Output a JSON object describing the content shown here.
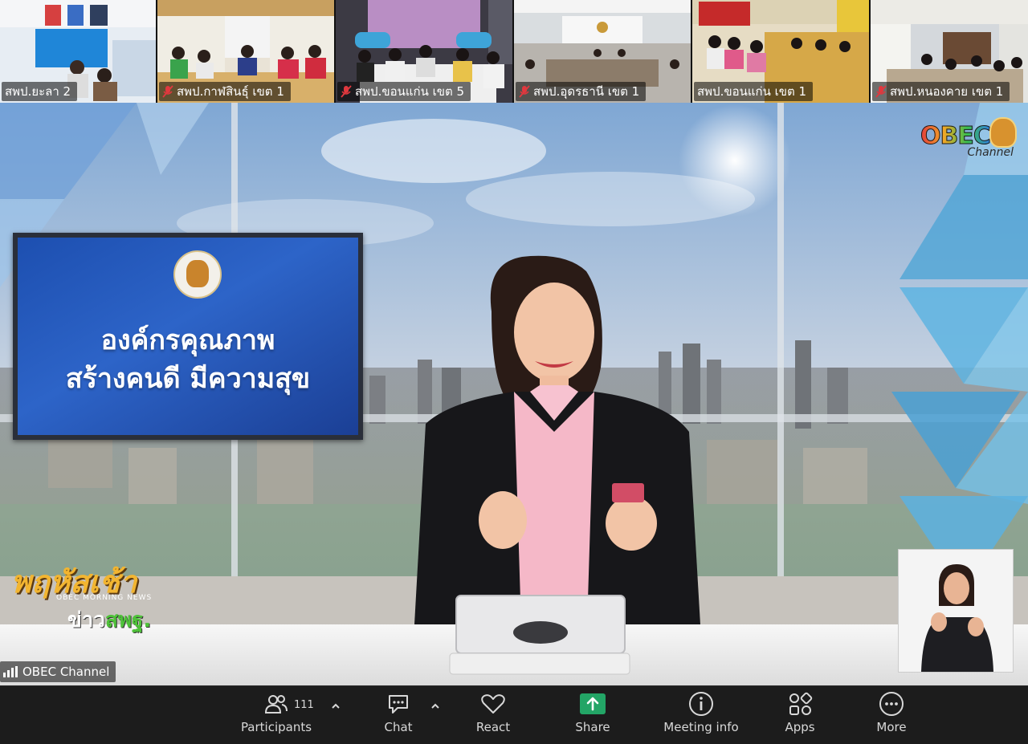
{
  "gallery": {
    "tiles": [
      {
        "label": "สพป.ยะลา 2",
        "muted": false
      },
      {
        "label": "สพป.กาฬสินธุ์ เขต 1",
        "muted": true
      },
      {
        "label": "สพป.ขอนแก่น เขต 5",
        "muted": true
      },
      {
        "label": "สพป.อุดรธานี เขต 1",
        "muted": true
      },
      {
        "label": "สพป.ขอนแก่น เขต 1",
        "muted": false
      },
      {
        "label": "สพป.หนองคาย เขต 1",
        "muted": true
      }
    ]
  },
  "studio": {
    "headline": {
      "line1": "องค์กรคุณภาพ",
      "line2": "สร้างคนดี มีความสุข"
    },
    "channel_logo": {
      "brand": "OBEC",
      "sub": "Channel"
    },
    "show_logo": {
      "title": "พฤหัสเช้า",
      "subtitle": "OBEC MORNING NEWS",
      "news_prefix": "ข่าว",
      "news_brand": "สพฐ."
    },
    "speaker_name": "OBEC Channel"
  },
  "toolbar": {
    "participants": {
      "label": "Participants",
      "count": "111"
    },
    "chat": {
      "label": "Chat"
    },
    "react": {
      "label": "React"
    },
    "share": {
      "label": "Share"
    },
    "meeting_info": {
      "label": "Meeting info"
    },
    "apps": {
      "label": "Apps"
    },
    "more": {
      "label": "More"
    }
  },
  "colors": {
    "toolbar_bg": "#1c1c1c",
    "share_green": "#23a566",
    "mute_red": "#e0383e"
  }
}
